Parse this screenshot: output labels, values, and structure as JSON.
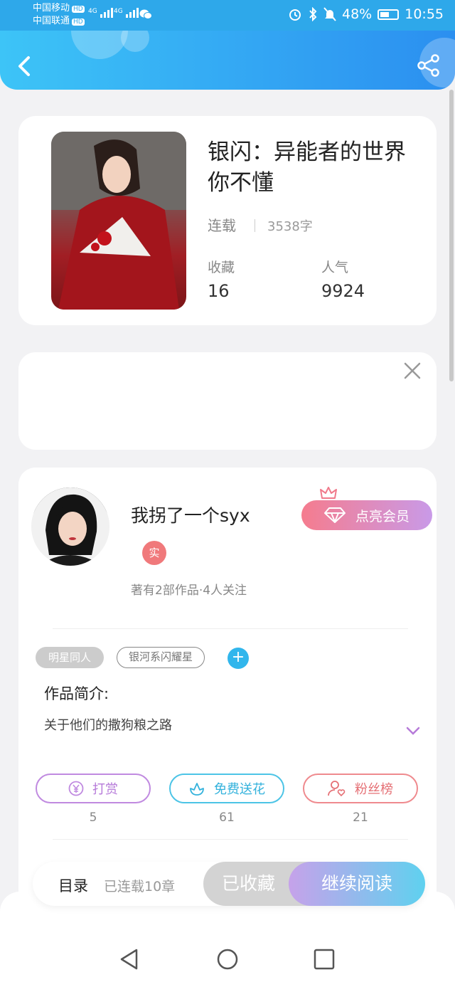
{
  "status_bar": {
    "carrier1": "中国移动",
    "carrier2": "中国联通",
    "hd": "HD",
    "network": "4G",
    "battery": "48%",
    "time": "10:55"
  },
  "book": {
    "title": "银闪：异能者的世界你不懂",
    "status": "连载",
    "word_count": "3538字",
    "favorites_label": "收藏",
    "favorites_value": "16",
    "popularity_label": "人气",
    "popularity_value": "9924"
  },
  "author": {
    "name": "我拐了一个syx",
    "verified_badge": "实",
    "info": "著有2部作品·4人关注",
    "vip_button": "点亮会员"
  },
  "tags": [
    "明星同人",
    "银河系闪耀星"
  ],
  "intro": {
    "title": "作品简介:",
    "text": "关于他们的撒狗粮之路"
  },
  "actions": [
    {
      "label": "打赏",
      "icon": "yen-icon",
      "count": "5",
      "color": "#b67ad9"
    },
    {
      "label": "免费送花",
      "icon": "flower-icon",
      "count": "61",
      "color": "#33b2dc"
    },
    {
      "label": "粉丝榜",
      "icon": "user-heart-icon",
      "count": "21",
      "color": "#e57075"
    }
  ],
  "bottom_bar": {
    "toc": "目录",
    "chapters": "已连载10章",
    "collected": "已收藏",
    "continue": "继续阅读"
  },
  "colors": {
    "header_start": "#3dc4f7",
    "header_end": "#2b8ff0",
    "vip_start": "#f57c8e",
    "vip_end": "#c99ae8"
  }
}
